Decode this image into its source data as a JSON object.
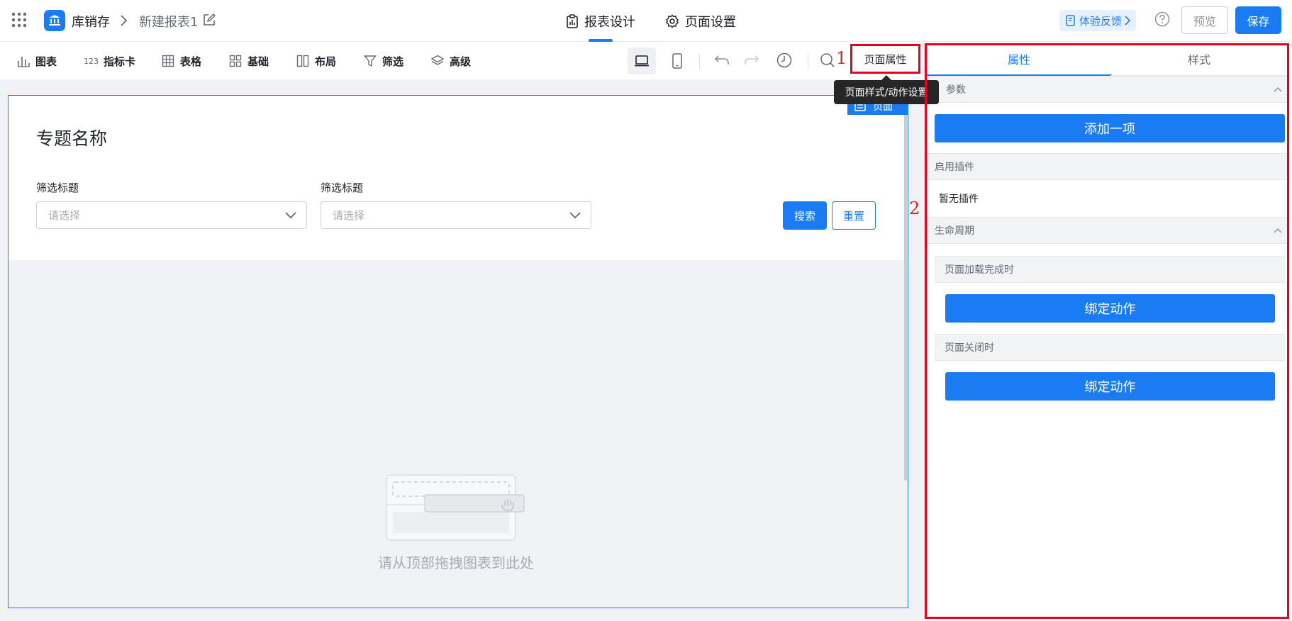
{
  "header": {
    "app_name": "库销存",
    "report_name": "新建报表1",
    "tabs": [
      {
        "label": "报表设计",
        "icon": "report-design-icon",
        "active": true
      },
      {
        "label": "页面设置",
        "icon": "gear-icon",
        "active": false
      }
    ],
    "feedback_label": "体验反馈",
    "preview_label": "预览",
    "save_label": "保存"
  },
  "toolbar": {
    "items": [
      {
        "label": "图表",
        "icon": "bar-chart-icon"
      },
      {
        "label": "指标卡",
        "icon": "metric-123-icon"
      },
      {
        "label": "表格",
        "icon": "table-grid-icon"
      },
      {
        "label": "基础",
        "icon": "basic-blocks-icon"
      },
      {
        "label": "布局",
        "icon": "layout-columns-icon"
      },
      {
        "label": "筛选",
        "icon": "filter-funnel-icon"
      },
      {
        "label": "高级",
        "icon": "layers-icon"
      }
    ],
    "page_attr_label": "页面属性",
    "tooltip": "页面样式/动作设置",
    "annotation_1": "1",
    "annotation_2": "2"
  },
  "canvas": {
    "page_badge": "页面",
    "topic_title": "专题名称",
    "filters": [
      {
        "label": "筛选标题",
        "placeholder": "请选择"
      },
      {
        "label": "筛选标题",
        "placeholder": "请选择"
      }
    ],
    "search_label": "搜索",
    "reset_label": "重置",
    "empty_hint": "请从顶部拖拽图表到此处"
  },
  "panel": {
    "tabs": [
      {
        "label": "属性",
        "active": true
      },
      {
        "label": "样式",
        "active": false
      }
    ],
    "params_title": "参数",
    "add_item_label": "添加一项",
    "plugins_title": "启用插件",
    "no_plugin_text": "暂无插件",
    "lifecycle_title": "生命周期",
    "on_load_title": "页面加载完成时",
    "on_close_title": "页面关闭时",
    "bind_action_label": "绑定动作"
  },
  "colors": {
    "accent": "#1a7cf5",
    "annotation_red": "#e8001c",
    "canvas_bg": "#f0f2f5"
  }
}
